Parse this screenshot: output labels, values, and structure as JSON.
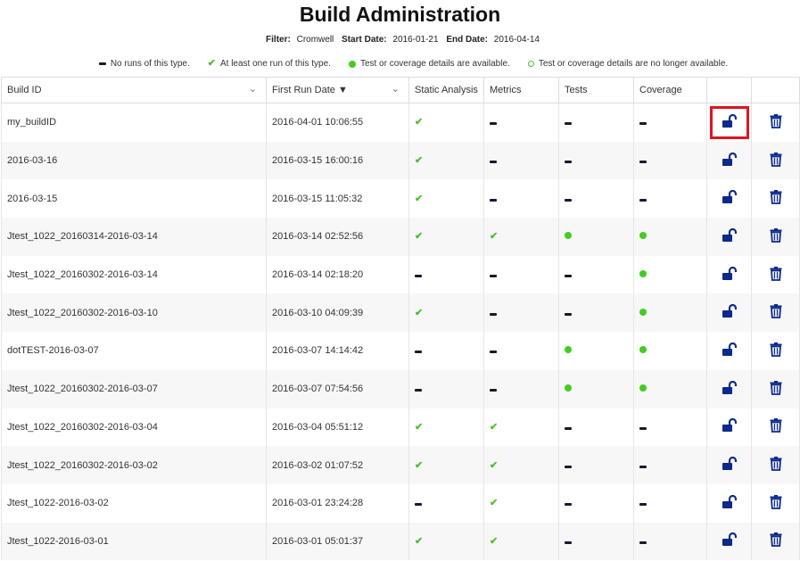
{
  "page": {
    "title": "Build Administration"
  },
  "filter": {
    "filter_label": "Filter:",
    "filter_value": "Cromwell",
    "start_label": "Start Date:",
    "start_value": "2016-01-21",
    "end_label": "End Date:",
    "end_value": "2016-04-14"
  },
  "legend": {
    "none": "No runs of this type.",
    "one_run": "At least one run of this type.",
    "available": "Test or coverage details are available.",
    "no_longer": "Test or coverage details are no longer available."
  },
  "columns": {
    "build_id": "Build ID",
    "first_run": "First Run Date ▼",
    "static": "Static Analysis",
    "metrics": "Metrics",
    "tests": "Tests",
    "coverage": "Coverage"
  },
  "rows": [
    {
      "build_id": "my_buildID",
      "date": "2016-04-01 10:06:55",
      "sa": "check",
      "metrics": "dash",
      "tests": "dash",
      "coverage": "dash"
    },
    {
      "build_id": "2016-03-16",
      "date": "2016-03-15 16:00:16",
      "sa": "check",
      "metrics": "dash",
      "tests": "dash",
      "coverage": "dash"
    },
    {
      "build_id": "2016-03-15",
      "date": "2016-03-15 11:05:32",
      "sa": "check",
      "metrics": "dash",
      "tests": "dash",
      "coverage": "dash"
    },
    {
      "build_id": "Jtest_1022_20160314-2016-03-14",
      "date": "2016-03-14 02:52:56",
      "sa": "check",
      "metrics": "check",
      "tests": "dot",
      "coverage": "dot"
    },
    {
      "build_id": "Jtest_1022_20160302-2016-03-14",
      "date": "2016-03-14 02:18:20",
      "sa": "dash",
      "metrics": "dash",
      "tests": "dash",
      "coverage": "dot"
    },
    {
      "build_id": "Jtest_1022_20160302-2016-03-10",
      "date": "2016-03-10 04:09:39",
      "sa": "check",
      "metrics": "dash",
      "tests": "dash",
      "coverage": "dot"
    },
    {
      "build_id": "dotTEST-2016-03-07",
      "date": "2016-03-07 14:14:42",
      "sa": "dash",
      "metrics": "dash",
      "tests": "dot",
      "coverage": "dot"
    },
    {
      "build_id": "Jtest_1022_20160302-2016-03-07",
      "date": "2016-03-07 07:54:56",
      "sa": "dash",
      "metrics": "dash",
      "tests": "dot",
      "coverage": "dot"
    },
    {
      "build_id": "Jtest_1022_20160302-2016-03-04",
      "date": "2016-03-04 05:51:12",
      "sa": "check",
      "metrics": "check",
      "tests": "dash",
      "coverage": "dash"
    },
    {
      "build_id": "Jtest_1022_20160302-2016-03-02",
      "date": "2016-03-02 01:07:52",
      "sa": "check",
      "metrics": "check",
      "tests": "dash",
      "coverage": "dash"
    },
    {
      "build_id": "Jtest_1022-2016-03-02",
      "date": "2016-03-01 23:24:28",
      "sa": "dash",
      "metrics": "check",
      "tests": "dash",
      "coverage": "dash"
    },
    {
      "build_id": "Jtest_1022-2016-03-01",
      "date": "2016-03-01 05:01:37",
      "sa": "check",
      "metrics": "check",
      "tests": "dash",
      "coverage": "dash"
    }
  ],
  "colors": {
    "check": "#4bbf2e",
    "dot": "#44cc22",
    "icon": "#0b2a8a",
    "highlight": "#e0141e"
  },
  "icons": {
    "lock": "unlocked-lock-icon",
    "delete": "trash-icon"
  }
}
